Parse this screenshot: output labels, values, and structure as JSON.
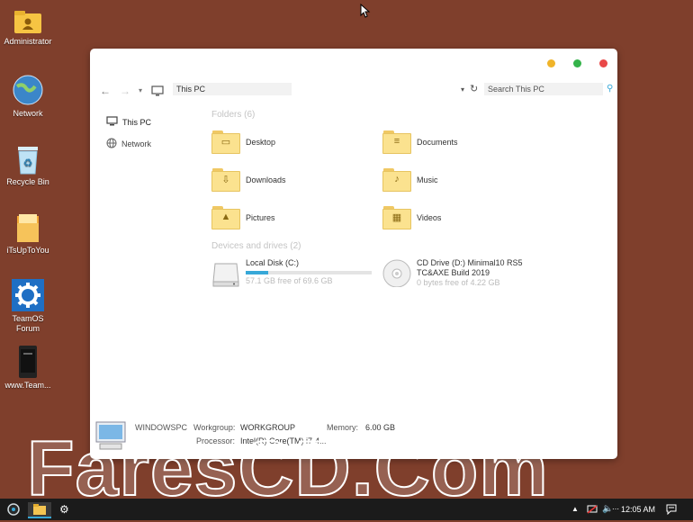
{
  "desktop": {
    "icons": [
      {
        "label": "Administrator",
        "icon": "user-folder-icon"
      },
      {
        "label": "Network",
        "icon": "network-globe-icon"
      },
      {
        "label": "Recycle Bin",
        "icon": "recycle-bin-icon"
      },
      {
        "label": "iTsUpToYou",
        "icon": "folder-icon"
      },
      {
        "label": "TeamOS Forum",
        "icon": "gear-shortcut-icon"
      },
      {
        "label": "www.Team...",
        "icon": "phone-shortcut-icon"
      }
    ]
  },
  "window": {
    "controls": {
      "minimize_color": "#f0b429",
      "maximize_color": "#34b34a",
      "close_color": "#e94848"
    },
    "address": {
      "path": "This PC",
      "search_placeholder": "Search This PC"
    },
    "sidebar": [
      {
        "label": "This PC",
        "icon": "computer-icon",
        "selected": true
      },
      {
        "label": "Network",
        "icon": "network-globe-icon",
        "selected": false
      }
    ],
    "folders_header": "Folders (6)",
    "folders": [
      {
        "label": "Desktop",
        "icon": "desktop-folder-icon"
      },
      {
        "label": "Documents",
        "icon": "documents-folder-icon"
      },
      {
        "label": "Downloads",
        "icon": "downloads-folder-icon"
      },
      {
        "label": "Music",
        "icon": "music-folder-icon"
      },
      {
        "label": "Pictures",
        "icon": "pictures-folder-icon"
      },
      {
        "label": "Videos",
        "icon": "videos-folder-icon"
      }
    ],
    "drives_header": "Devices and drives (2)",
    "drives": [
      {
        "label": "Local Disk (C:)",
        "free": "57.1 GB free of 69.6 GB",
        "used_fraction": 0.18,
        "icon": "hard-drive-icon"
      },
      {
        "label": "CD Drive (D:) Minimal10 RS5",
        "label2": "TC&AXE Build 2019",
        "free": "0 bytes free of 4.22 GB",
        "icon": "cd-drive-icon"
      }
    ],
    "details": {
      "computer_name": "WINDOWSPC",
      "workgroup_label": "Workgroup:",
      "workgroup": "WORKGROUP",
      "memory_label": "Memory:",
      "memory": "6.00 GB",
      "processor_label": "Processor:",
      "processor": "Intel(R) Core(TM) i7-4..."
    }
  },
  "taskbar": {
    "clock": "12:05 AM",
    "accent": "#37a8d8"
  },
  "watermark": "FaresCD.Com"
}
